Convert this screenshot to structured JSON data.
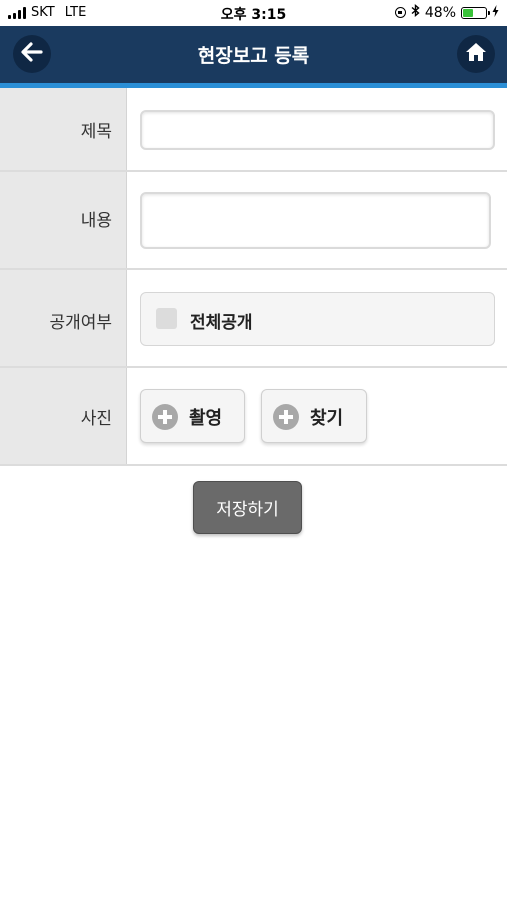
{
  "status_bar": {
    "carrier": "SKT",
    "network": "LTE",
    "time": "오후 3:15",
    "battery_percent": "48%",
    "battery_level": 0.48,
    "icons": [
      "signal-icon",
      "rotation-lock-icon",
      "bluetooth-icon",
      "battery-icon",
      "charging-icon"
    ]
  },
  "header": {
    "title": "현장보고 등록",
    "back_icon": "back-arrow-icon",
    "home_icon": "home-icon",
    "background_color": "#1a3a5f",
    "accent_color": "#2b8fd6"
  },
  "form": {
    "title_label": "제목",
    "title_value": "",
    "content_label": "내용",
    "content_value": "",
    "visibility_label": "공개여부",
    "visibility_option": "전체공개",
    "visibility_checked": false,
    "photo_label": "사진",
    "photo_capture_label": "촬영",
    "photo_browse_label": "찾기"
  },
  "save_button": {
    "label": "저장하기",
    "color": "#6a6a6a"
  }
}
